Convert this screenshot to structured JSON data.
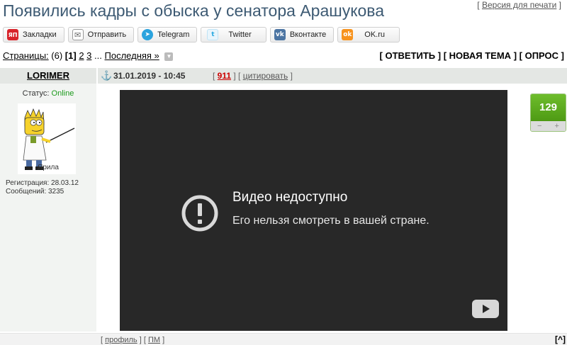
{
  "page": {
    "title": "Появились кадры с обыска у сенатора Арашукова",
    "print_version": "Версия для печати"
  },
  "share": [
    {
      "label": "Закладки",
      "icon": "yandex-bookmarks-icon",
      "color": "#d8232a",
      "glyph": "ЯП"
    },
    {
      "label": "Отправить",
      "icon": "mail-icon",
      "color": "#ffffff",
      "glyph": "✉"
    },
    {
      "label": "Telegram",
      "icon": "telegram-icon",
      "color": "#2aa3de",
      "glyph": "➤"
    },
    {
      "label": "Twitter",
      "icon": "twitter-icon",
      "color": "#e9f5fc",
      "glyph": "t"
    },
    {
      "label": "Вконтакте",
      "icon": "vk-icon",
      "color": "#4c75a3",
      "glyph": "vk"
    },
    {
      "label": "OK.ru",
      "icon": "ok-icon",
      "color": "#f7931e",
      "glyph": "ok"
    }
  ],
  "pagination": {
    "label": "Страницы:",
    "count": "(6)",
    "current": "[1]",
    "page2": "2",
    "page3": "3",
    "ellipsis": "...",
    "last": "Последняя »"
  },
  "actions": {
    "reply": "ОТВЕТИТЬ",
    "new_topic": "НОВАЯ ТЕМА",
    "poll": "ОПРОС"
  },
  "post": {
    "author": "LORIMER",
    "date": "31.01.2019 - 10:45",
    "post_number": "911",
    "quote": "цитировать",
    "status_label": "Статус:",
    "status_value": "Online",
    "avatar_caption": "Ярила",
    "registration": "Регистрация: 28.03.12",
    "messages": "Сообщений: 3235",
    "rating": "129",
    "rating_minus": "−",
    "rating_plus": "+"
  },
  "video": {
    "title": "Видео недоступно",
    "message": "Его нельзя смотреть в вашей стране."
  },
  "footer": {
    "profile": "профиль",
    "pm": "ПМ",
    "to_top": "[^]"
  }
}
